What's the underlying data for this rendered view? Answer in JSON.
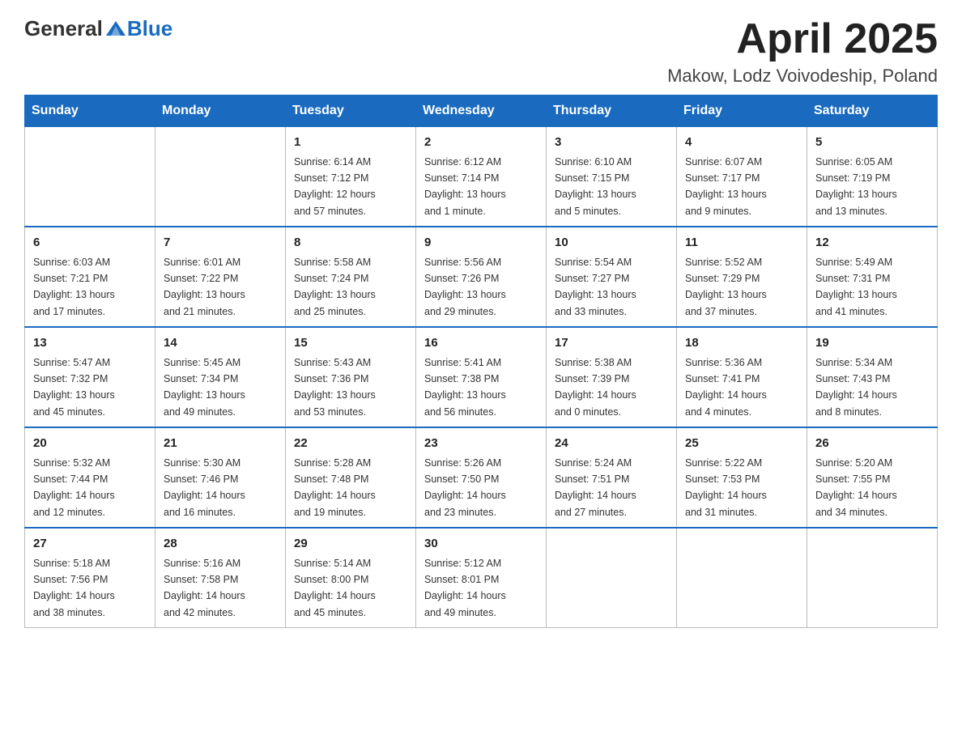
{
  "header": {
    "logo_general": "General",
    "logo_blue": "Blue",
    "month_title": "April 2025",
    "location": "Makow, Lodz Voivodeship, Poland"
  },
  "weekdays": [
    "Sunday",
    "Monday",
    "Tuesday",
    "Wednesday",
    "Thursday",
    "Friday",
    "Saturday"
  ],
  "weeks": [
    [
      {
        "day": "",
        "info": ""
      },
      {
        "day": "",
        "info": ""
      },
      {
        "day": "1",
        "info": "Sunrise: 6:14 AM\nSunset: 7:12 PM\nDaylight: 12 hours\nand 57 minutes."
      },
      {
        "day": "2",
        "info": "Sunrise: 6:12 AM\nSunset: 7:14 PM\nDaylight: 13 hours\nand 1 minute."
      },
      {
        "day": "3",
        "info": "Sunrise: 6:10 AM\nSunset: 7:15 PM\nDaylight: 13 hours\nand 5 minutes."
      },
      {
        "day": "4",
        "info": "Sunrise: 6:07 AM\nSunset: 7:17 PM\nDaylight: 13 hours\nand 9 minutes."
      },
      {
        "day": "5",
        "info": "Sunrise: 6:05 AM\nSunset: 7:19 PM\nDaylight: 13 hours\nand 13 minutes."
      }
    ],
    [
      {
        "day": "6",
        "info": "Sunrise: 6:03 AM\nSunset: 7:21 PM\nDaylight: 13 hours\nand 17 minutes."
      },
      {
        "day": "7",
        "info": "Sunrise: 6:01 AM\nSunset: 7:22 PM\nDaylight: 13 hours\nand 21 minutes."
      },
      {
        "day": "8",
        "info": "Sunrise: 5:58 AM\nSunset: 7:24 PM\nDaylight: 13 hours\nand 25 minutes."
      },
      {
        "day": "9",
        "info": "Sunrise: 5:56 AM\nSunset: 7:26 PM\nDaylight: 13 hours\nand 29 minutes."
      },
      {
        "day": "10",
        "info": "Sunrise: 5:54 AM\nSunset: 7:27 PM\nDaylight: 13 hours\nand 33 minutes."
      },
      {
        "day": "11",
        "info": "Sunrise: 5:52 AM\nSunset: 7:29 PM\nDaylight: 13 hours\nand 37 minutes."
      },
      {
        "day": "12",
        "info": "Sunrise: 5:49 AM\nSunset: 7:31 PM\nDaylight: 13 hours\nand 41 minutes."
      }
    ],
    [
      {
        "day": "13",
        "info": "Sunrise: 5:47 AM\nSunset: 7:32 PM\nDaylight: 13 hours\nand 45 minutes."
      },
      {
        "day": "14",
        "info": "Sunrise: 5:45 AM\nSunset: 7:34 PM\nDaylight: 13 hours\nand 49 minutes."
      },
      {
        "day": "15",
        "info": "Sunrise: 5:43 AM\nSunset: 7:36 PM\nDaylight: 13 hours\nand 53 minutes."
      },
      {
        "day": "16",
        "info": "Sunrise: 5:41 AM\nSunset: 7:38 PM\nDaylight: 13 hours\nand 56 minutes."
      },
      {
        "day": "17",
        "info": "Sunrise: 5:38 AM\nSunset: 7:39 PM\nDaylight: 14 hours\nand 0 minutes."
      },
      {
        "day": "18",
        "info": "Sunrise: 5:36 AM\nSunset: 7:41 PM\nDaylight: 14 hours\nand 4 minutes."
      },
      {
        "day": "19",
        "info": "Sunrise: 5:34 AM\nSunset: 7:43 PM\nDaylight: 14 hours\nand 8 minutes."
      }
    ],
    [
      {
        "day": "20",
        "info": "Sunrise: 5:32 AM\nSunset: 7:44 PM\nDaylight: 14 hours\nand 12 minutes."
      },
      {
        "day": "21",
        "info": "Sunrise: 5:30 AM\nSunset: 7:46 PM\nDaylight: 14 hours\nand 16 minutes."
      },
      {
        "day": "22",
        "info": "Sunrise: 5:28 AM\nSunset: 7:48 PM\nDaylight: 14 hours\nand 19 minutes."
      },
      {
        "day": "23",
        "info": "Sunrise: 5:26 AM\nSunset: 7:50 PM\nDaylight: 14 hours\nand 23 minutes."
      },
      {
        "day": "24",
        "info": "Sunrise: 5:24 AM\nSunset: 7:51 PM\nDaylight: 14 hours\nand 27 minutes."
      },
      {
        "day": "25",
        "info": "Sunrise: 5:22 AM\nSunset: 7:53 PM\nDaylight: 14 hours\nand 31 minutes."
      },
      {
        "day": "26",
        "info": "Sunrise: 5:20 AM\nSunset: 7:55 PM\nDaylight: 14 hours\nand 34 minutes."
      }
    ],
    [
      {
        "day": "27",
        "info": "Sunrise: 5:18 AM\nSunset: 7:56 PM\nDaylight: 14 hours\nand 38 minutes."
      },
      {
        "day": "28",
        "info": "Sunrise: 5:16 AM\nSunset: 7:58 PM\nDaylight: 14 hours\nand 42 minutes."
      },
      {
        "day": "29",
        "info": "Sunrise: 5:14 AM\nSunset: 8:00 PM\nDaylight: 14 hours\nand 45 minutes."
      },
      {
        "day": "30",
        "info": "Sunrise: 5:12 AM\nSunset: 8:01 PM\nDaylight: 14 hours\nand 49 minutes."
      },
      {
        "day": "",
        "info": ""
      },
      {
        "day": "",
        "info": ""
      },
      {
        "day": "",
        "info": ""
      }
    ]
  ]
}
